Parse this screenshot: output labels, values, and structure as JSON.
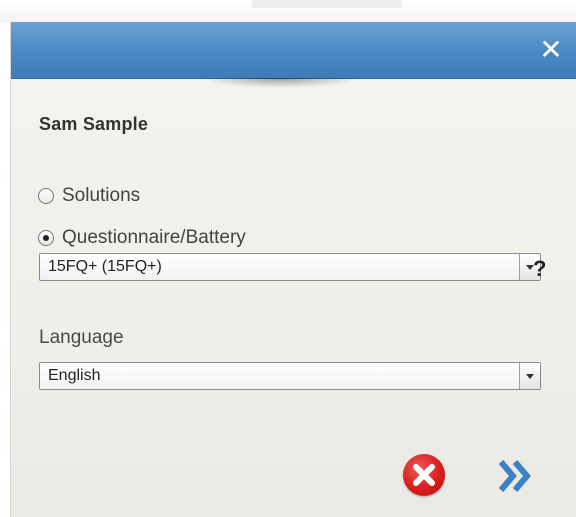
{
  "dialog": {
    "close_icon": "close-x-icon",
    "candidate_name": "Sam Sample"
  },
  "options": {
    "solutions_label": "Solutions",
    "questionnaire_label": "Questionnaire/Battery",
    "selected": "Questionnaire/Battery"
  },
  "questionnaire_select": {
    "value": "15FQ+ (15FQ+)",
    "help_label": "?"
  },
  "language": {
    "label": "Language",
    "value": "English"
  },
  "actions": {
    "cancel_icon": "cancel-circle-icon",
    "next_icon": "double-chevron-right-icon"
  },
  "colors": {
    "titlebar": "#4b88c3",
    "cancel": "#d91d1d",
    "next": "#3b82c4",
    "body_bg": "#f0efea"
  }
}
